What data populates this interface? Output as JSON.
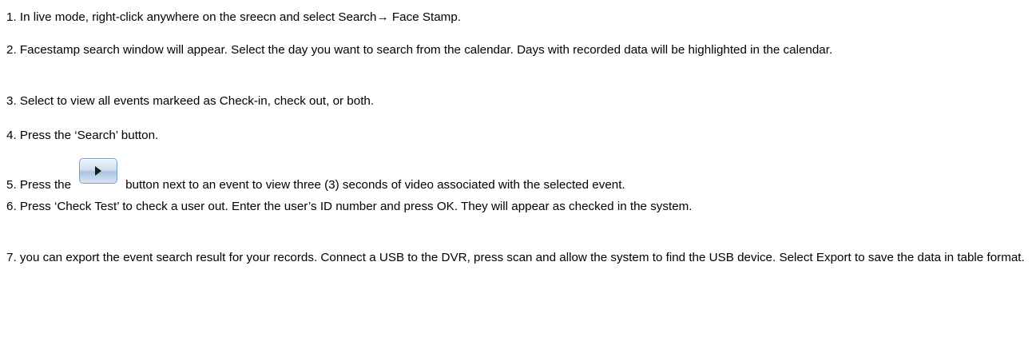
{
  "steps": [
    {
      "number": "1.",
      "text": "In live mode, right-click anywhere on the sreecn and select Search→ Face Stamp."
    },
    {
      "number": "2.",
      "text": "Facestamp search window will appear. Select the day you want to search from the calendar. Days with recorded data will be highlighted in the calendar."
    },
    {
      "number": "3.",
      "text": "Select to view all events markeed as Check-in, check out, or both."
    },
    {
      "number": "4.",
      "text": "Press the ‘Search’ button."
    },
    {
      "number": "5.",
      "text_before": "Press the",
      "icon": "play-button-icon",
      "text_after": "button next to an event to view three (3) seconds of video associated with the selected event."
    },
    {
      "number": "6.",
      "text": "Press ‘Check Test’ to check a user out. Enter the user’s ID number and press OK. They will appear as checked in the system."
    },
    {
      "number": "7.",
      "text": "you can export the event search result for your records. Connect a USB to the DVR, press scan and allow the system to find the USB device. Select Export to save the data in table format."
    }
  ]
}
